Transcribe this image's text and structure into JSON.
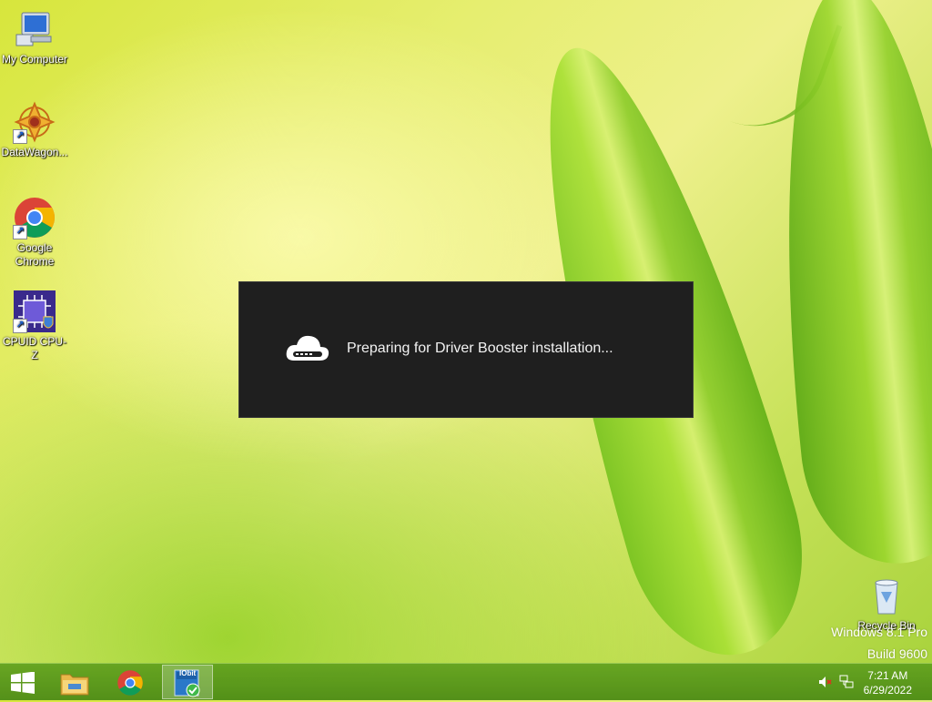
{
  "desktop": {
    "icons": [
      {
        "label": "My Computer",
        "icon": "my-computer-icon"
      },
      {
        "label": "DataWagon...",
        "icon": "datawagon-icon"
      },
      {
        "label": "Google Chrome",
        "icon": "chrome-icon"
      },
      {
        "label": "CPUID CPU-Z",
        "icon": "cpuz-icon"
      },
      {
        "label": "Recycle Bin",
        "icon": "recycle-bin-icon"
      }
    ],
    "watermark_line1": "Windows 8.1 Pro",
    "watermark_line2": "Build 9600"
  },
  "dialog": {
    "message": "Preparing for Driver Booster installation...",
    "icon": "cloud-upload-icon",
    "background": "#1f1f1f"
  },
  "taskbar": {
    "buttons": [
      {
        "name": "start-button",
        "icon": "windows-logo-icon"
      },
      {
        "name": "file-explorer-button",
        "icon": "folder-icon"
      },
      {
        "name": "chrome-button",
        "icon": "chrome-icon"
      },
      {
        "name": "iobit-button",
        "icon": "iobit-icon",
        "label": "IObit",
        "active": true
      }
    ],
    "tray": {
      "volume_icon": "volume-muted-icon",
      "network_icon": "network-icon",
      "time": "7:21 AM",
      "date": "6/29/2022"
    }
  }
}
